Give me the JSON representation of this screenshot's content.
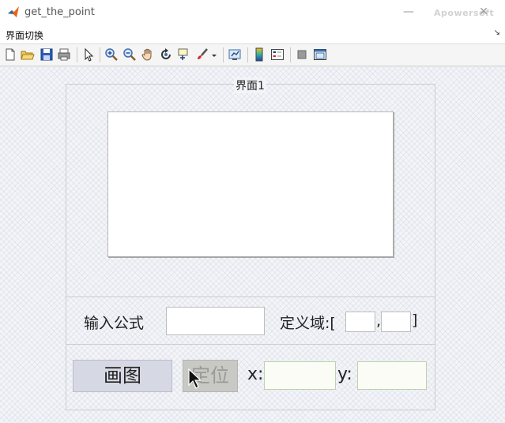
{
  "window": {
    "title": "get_the_point",
    "minimize_glyph": "—",
    "close_glyph": "✕",
    "watermark": "Apowersoft"
  },
  "menubar": {
    "items": [
      {
        "label": "界面切换"
      }
    ],
    "collapse_glyph": "↘"
  },
  "toolbar": {
    "icons": [
      "new-figure-icon",
      "open-file-icon",
      "save-icon",
      "print-icon",
      "select-arrow-icon",
      "zoom-in-icon",
      "zoom-out-icon",
      "pan-hand-icon",
      "rotate-3d-icon",
      "data-cursor-icon",
      "brush-icon",
      "link-plot-icon",
      "colorbar-icon",
      "legend-icon",
      "hide-plot-tools-icon",
      "show-plot-tools-icon"
    ]
  },
  "panel_main": {
    "title": "界面1"
  },
  "input_row": {
    "formula_label": "输入公式",
    "formula_value": "",
    "domain_label": "定义域:[",
    "domain_min": "",
    "domain_separator": ",",
    "domain_max": "",
    "domain_close": "]"
  },
  "action_row": {
    "plot_label": "画图",
    "locate_label": "定位",
    "x_label": "x:",
    "x_value": "",
    "y_label": "y:",
    "y_value": ""
  },
  "colors": {
    "plot_button_bg": "#d6d9e4",
    "locate_button_bg": "#c8c8c4",
    "locate_text": "#9a9a95",
    "xy_field_border": "#b9d3ad"
  }
}
